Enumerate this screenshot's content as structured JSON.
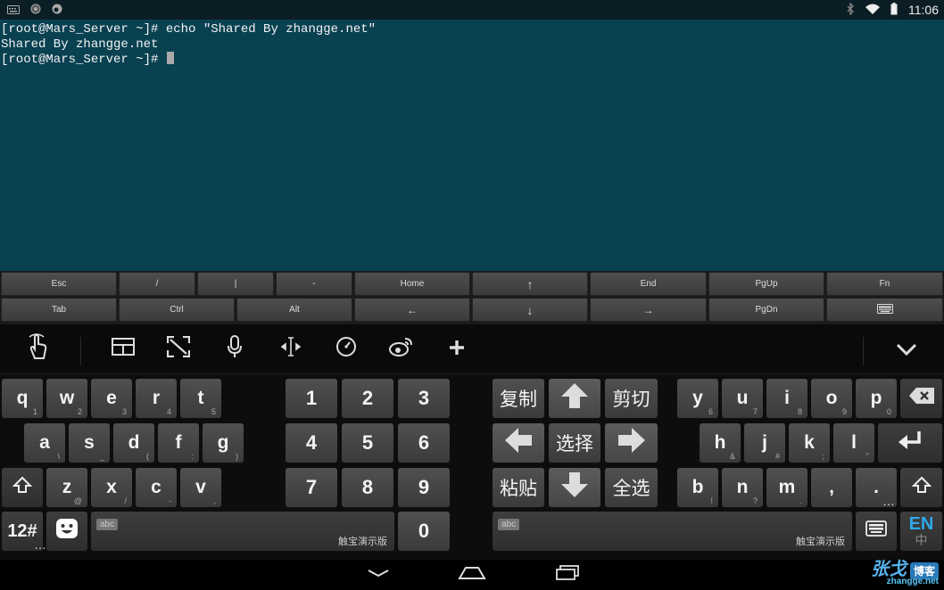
{
  "status": {
    "time": "11:06"
  },
  "terminal": {
    "lines": [
      "[root@Mars_Server ~]# echo \"Shared By zhangge.net\"",
      "Shared By zhangge.net",
      "[root@Mars_Server ~]# "
    ]
  },
  "extra_keys": {
    "row1": [
      "Esc",
      "/",
      "|",
      "-",
      "Home",
      "↑",
      "End",
      "PgUp",
      "Fn"
    ],
    "row2": [
      "Tab",
      "Ctrl",
      "Alt",
      "←",
      "↓",
      "→",
      "PgDn"
    ]
  },
  "keyboard": {
    "left_rows": [
      [
        {
          "k": "q",
          "s": "1"
        },
        {
          "k": "w",
          "s": "2"
        },
        {
          "k": "e",
          "s": "3"
        },
        {
          "k": "r",
          "s": "4"
        },
        {
          "k": "t",
          "s": "5"
        }
      ],
      [
        {
          "k": "a",
          "s": "\\"
        },
        {
          "k": "s",
          "s": "_"
        },
        {
          "k": "d",
          "s": "("
        },
        {
          "k": "f",
          "s": ":"
        },
        {
          "k": "g",
          "s": ")"
        }
      ],
      [
        {
          "k": "z",
          "s": "@"
        },
        {
          "k": "x",
          "s": "/"
        },
        {
          "k": "c",
          "s": "-"
        },
        {
          "k": "v",
          "s": ","
        }
      ]
    ],
    "numpad": [
      "1",
      "2",
      "3",
      "4",
      "5",
      "6",
      "7",
      "8",
      "9",
      "0"
    ],
    "edit_keys": {
      "copy": "复制",
      "cut": "剪切",
      "select": "选择",
      "paste": "粘贴",
      "select_all": "全选"
    },
    "right_rows": [
      [
        {
          "k": "y",
          "s": "6"
        },
        {
          "k": "u",
          "s": "7"
        },
        {
          "k": "i",
          "s": "8"
        },
        {
          "k": "o",
          "s": "9"
        },
        {
          "k": "p",
          "s": "0"
        }
      ],
      [
        {
          "k": "h",
          "s": "&"
        },
        {
          "k": "j",
          "s": "#"
        },
        {
          "k": "k",
          "s": ";"
        },
        {
          "k": "l",
          "s": "\""
        }
      ],
      [
        {
          "k": "b",
          "s": "!"
        },
        {
          "k": "n",
          "s": "?"
        },
        {
          "k": "m",
          "s": "."
        },
        {
          "k": ",",
          "s": ""
        },
        {
          "k": ".",
          "s": "…"
        }
      ]
    ],
    "symbols_key": "12#",
    "symbols_sub": "…",
    "space_tag": "abc",
    "space_name": "触宝演示版",
    "lang_en": "EN",
    "lang_cn": "中"
  },
  "watermark": {
    "cn": "张戈",
    "box": "博客",
    "url": "zhangge.net"
  }
}
